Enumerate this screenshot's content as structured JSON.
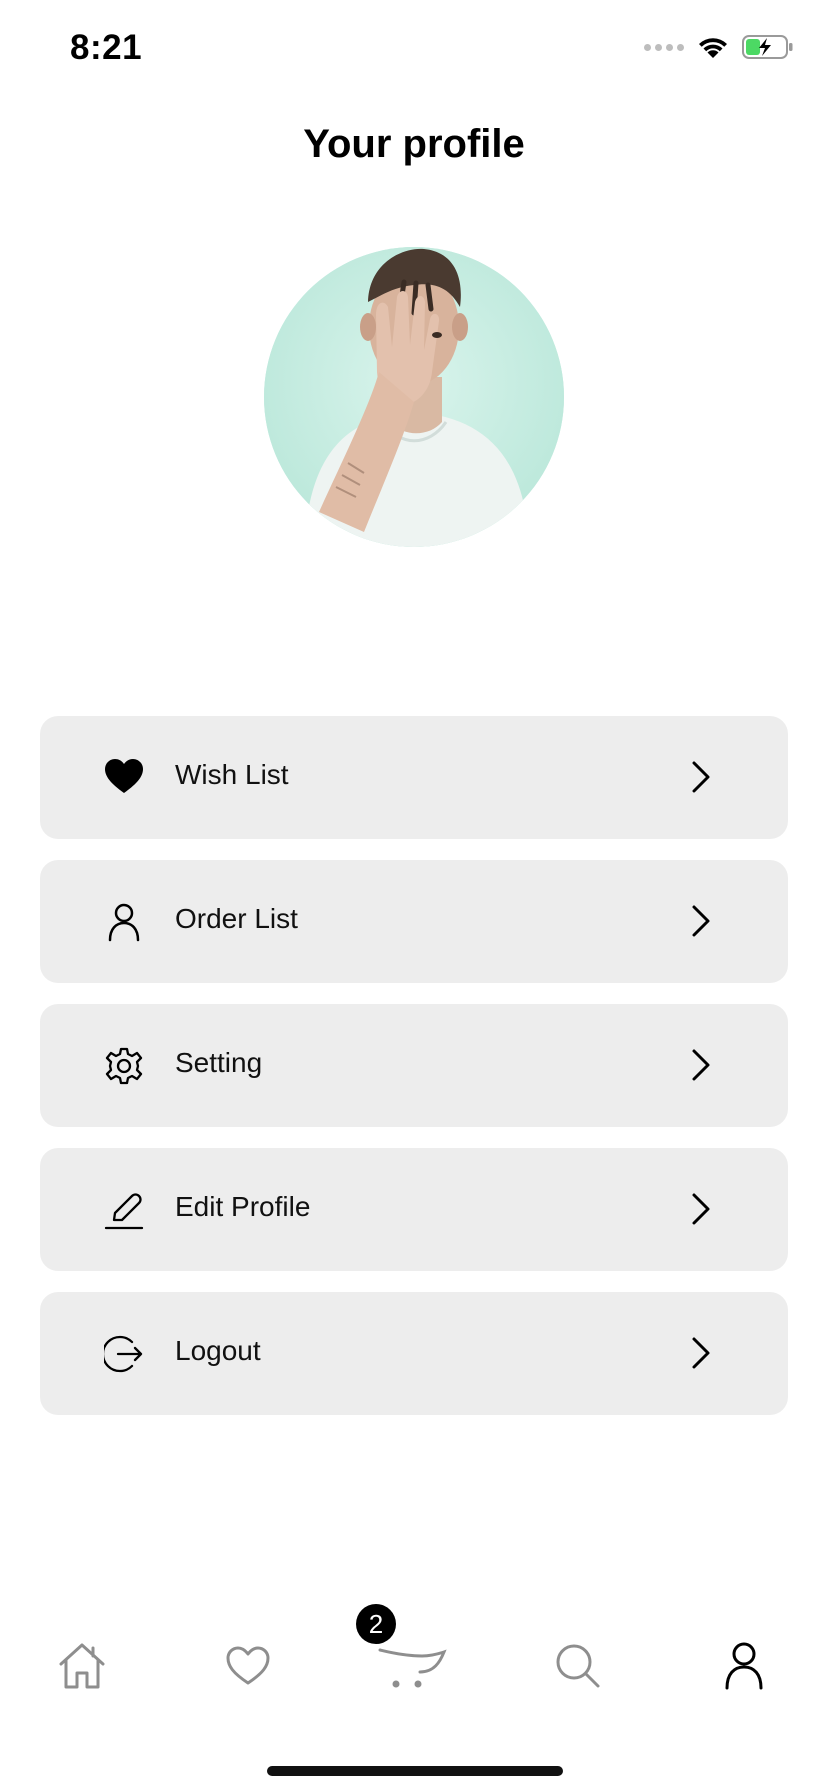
{
  "status_bar": {
    "time": "8:21",
    "icons": [
      "signal-dots-icon",
      "wifi-icon",
      "battery-charging-icon"
    ]
  },
  "header": {
    "title": "Your profile"
  },
  "avatar": {
    "icon": "profile-photo"
  },
  "menu": {
    "items": [
      {
        "label": "Wish List",
        "icon": "heart-filled-icon"
      },
      {
        "label": "Order List",
        "icon": "person-icon"
      },
      {
        "label": "Setting",
        "icon": "gear-icon"
      },
      {
        "label": "Edit Profile",
        "icon": "pencil-icon"
      },
      {
        "label": "Logout",
        "icon": "logout-icon"
      }
    ],
    "chevron_icon": "chevron-right-icon",
    "item_background": "#ededed"
  },
  "tab_bar": {
    "tabs": [
      {
        "name": "home",
        "icon": "home-icon",
        "active": false
      },
      {
        "name": "wishlist",
        "icon": "heart-outline-icon",
        "active": false
      },
      {
        "name": "cart",
        "icon": "cart-icon",
        "active": false
      },
      {
        "name": "search",
        "icon": "search-icon",
        "active": false
      },
      {
        "name": "profile",
        "icon": "person-icon",
        "active": true
      }
    ],
    "cart_badge": "2",
    "inactive_color": "#8e8e8e",
    "active_color": "#000000"
  }
}
